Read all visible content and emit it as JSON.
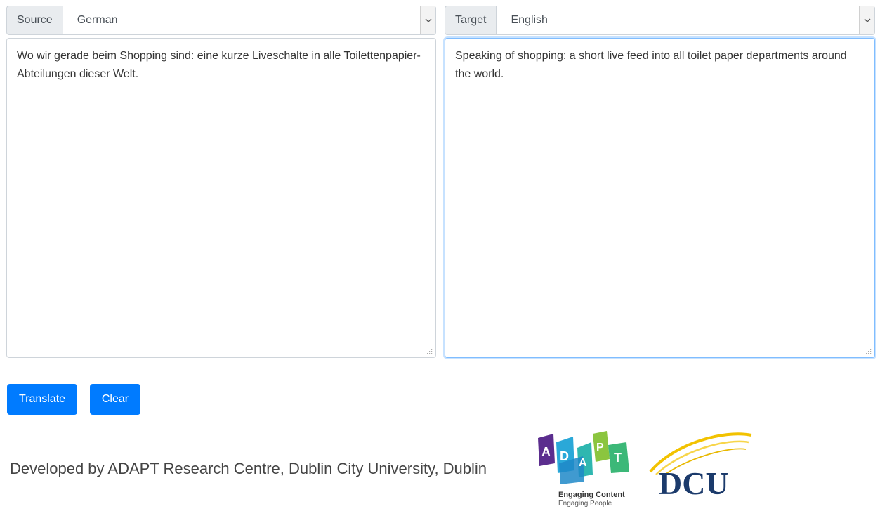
{
  "source": {
    "addon_label": "Source",
    "language": "German",
    "text": "Wo wir gerade beim Shopping sind: eine kurze Liveschalte in alle Toilettenpapier-Abteilungen dieser Welt."
  },
  "target": {
    "addon_label": "Target",
    "language": "English",
    "text": "Speaking of shopping: a short live feed into all toilet paper departments around the world."
  },
  "buttons": {
    "translate": "Translate",
    "clear": "Clear"
  },
  "footer": {
    "text": "Developed by ADAPT Research Centre, Dublin City University, Dublin",
    "adapt_logo": {
      "letters": [
        "A",
        "D",
        "A",
        "P",
        "T"
      ],
      "line1": "Engaging Content",
      "line2": "Engaging People"
    },
    "dcu_logo": {
      "text": "DCU"
    }
  },
  "colors": {
    "primary": "#007bff",
    "addon_bg": "#e9ecef",
    "border": "#ced4da",
    "focus_border": "#80bdff",
    "dcu_navy": "#1b3a6b",
    "dcu_gold": "#f2c200"
  }
}
